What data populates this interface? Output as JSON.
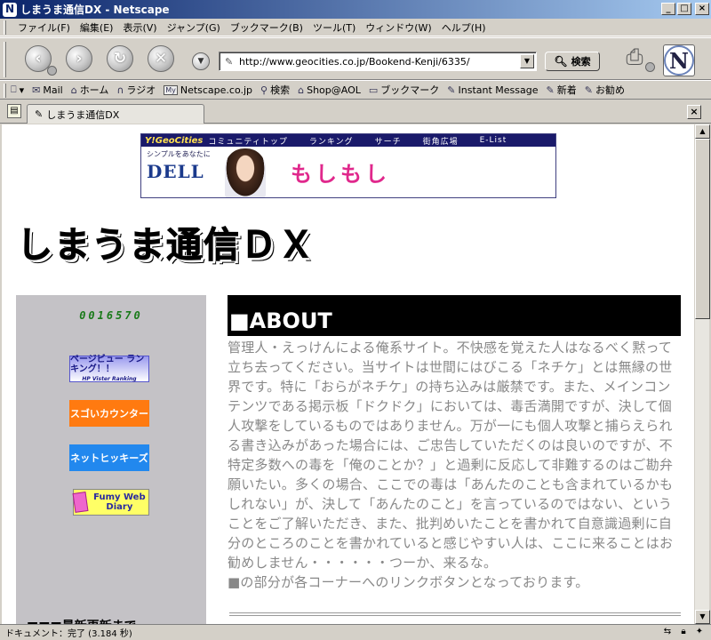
{
  "window": {
    "title": "しまうま通信DX - Netscape",
    "min_glyph": "_",
    "max_glyph": "□",
    "close_glyph": "×"
  },
  "menu": [
    "ファイル(F)",
    "編集(E)",
    "表示(V)",
    "ジャンプ(G)",
    "ブックマーク(B)",
    "ツール(T)",
    "ウィンドウ(W)",
    "ヘルプ(H)"
  ],
  "nav": {
    "url": "http://www.geocities.co.jp/Bookend-Kenji/6335/",
    "search_label": "検索"
  },
  "bookmarks": [
    "Mail",
    "ホーム",
    "ラジオ",
    "Netscape.co.jp",
    "検索",
    "Shop@AOL",
    "ブックマーク",
    "Instant Message",
    "新着",
    "お勧め"
  ],
  "bookmark_icons": {
    "mail": "envelope-icon",
    "home": "house-icon",
    "radio": "headphones-icon",
    "search": "magnifier-icon"
  },
  "tab": {
    "label": "しまうま通信DX"
  },
  "banner": {
    "geo_logo": "Y!GeoCities",
    "geo_items": [
      "コミュニティトップ",
      "ランキング",
      "サーチ",
      "街角広場",
      "E-List"
    ],
    "promo": "シンプルをあなたに",
    "brand": "DELL",
    "tagline": "もしもし"
  },
  "site": {
    "title": "しまうま通信ＤＸ",
    "counter": "0016570",
    "sidebar_buttons": {
      "ranking": "ページビュー ランキング！！",
      "ranking_sub": "HP Vister Ranking",
      "counter_btn": "スゴいカウンター",
      "hikki": "ネットヒッキーズ",
      "diary": "Fumy Web Diary"
    },
    "sidebar_heading": "■■■最新更新まで"
  },
  "about": {
    "heading": "■ABOUT",
    "body": "管理人・えっけんによる俺系サイト。不快感を覚えた人はなるべく黙って立ち去ってください。当サイトは世間にはびこる「ネチケ」とは無縁の世界です。特に「おらがネチケ」の持ち込みは厳禁です。また、メインコンテンツである掲示板「ドクドク」においては、毒舌満開ですが、決して個人攻撃をしているものではありません。万が一にも個人攻撃と捕らえられる書き込みがあった場合には、ご忠告していただくのは良いのですが、不特定多数への毒を「俺のことか？」と過剰に反応して非難するのはご勘弁願いたい。多くの場合、ここでの毒は「あんたのことも含まれているかもしれない」が、決して「あんたのこと」を言っているのではない、ということをご了解いただき、また、批判めいたことを書かれて自意識過剰に自分のところのことを書かれていると感じやすい人は、ここに来ることはお勧めしません・・・・・・つーか、来るな。",
    "note": "■の部分が各コーナーへのリンクボタンとなっております。"
  },
  "status": {
    "text": "ドキュメント：完了 (3.184 秒)"
  }
}
